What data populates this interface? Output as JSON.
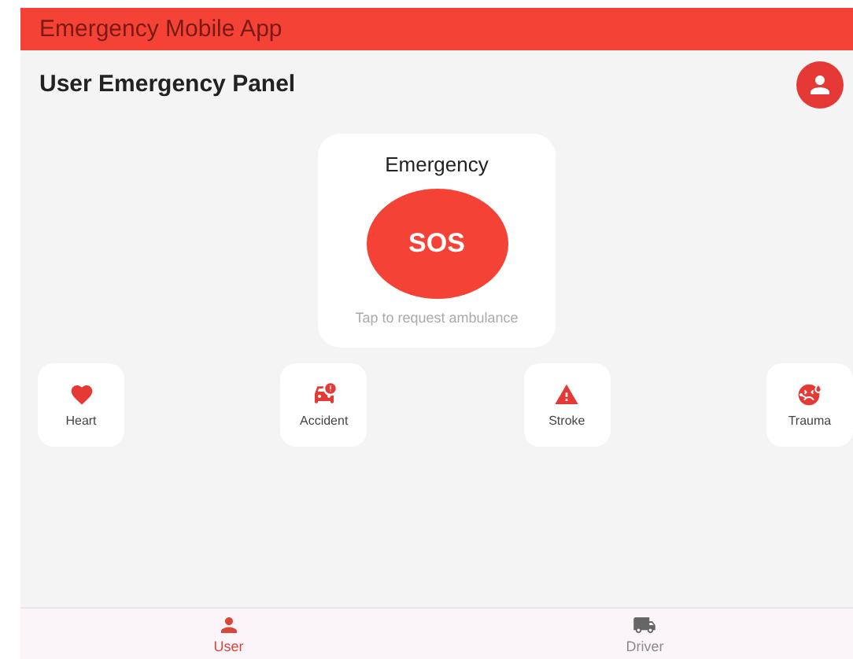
{
  "app_bar": {
    "title": "Emergency Mobile App"
  },
  "header": {
    "title": "User Emergency Panel"
  },
  "emergency_card": {
    "title": "Emergency",
    "sos_button": "SOS",
    "hint": "Tap to request ambulance"
  },
  "categories": [
    {
      "label": "Heart",
      "kind": "heart"
    },
    {
      "label": "Accident",
      "kind": "accident"
    },
    {
      "label": "Stroke",
      "kind": "stroke"
    },
    {
      "label": "Trauma",
      "kind": "trauma"
    }
  ],
  "bottom_nav": [
    {
      "label": "User",
      "kind": "user",
      "selected": true
    },
    {
      "label": "Driver",
      "kind": "driver",
      "selected": false
    }
  ]
}
